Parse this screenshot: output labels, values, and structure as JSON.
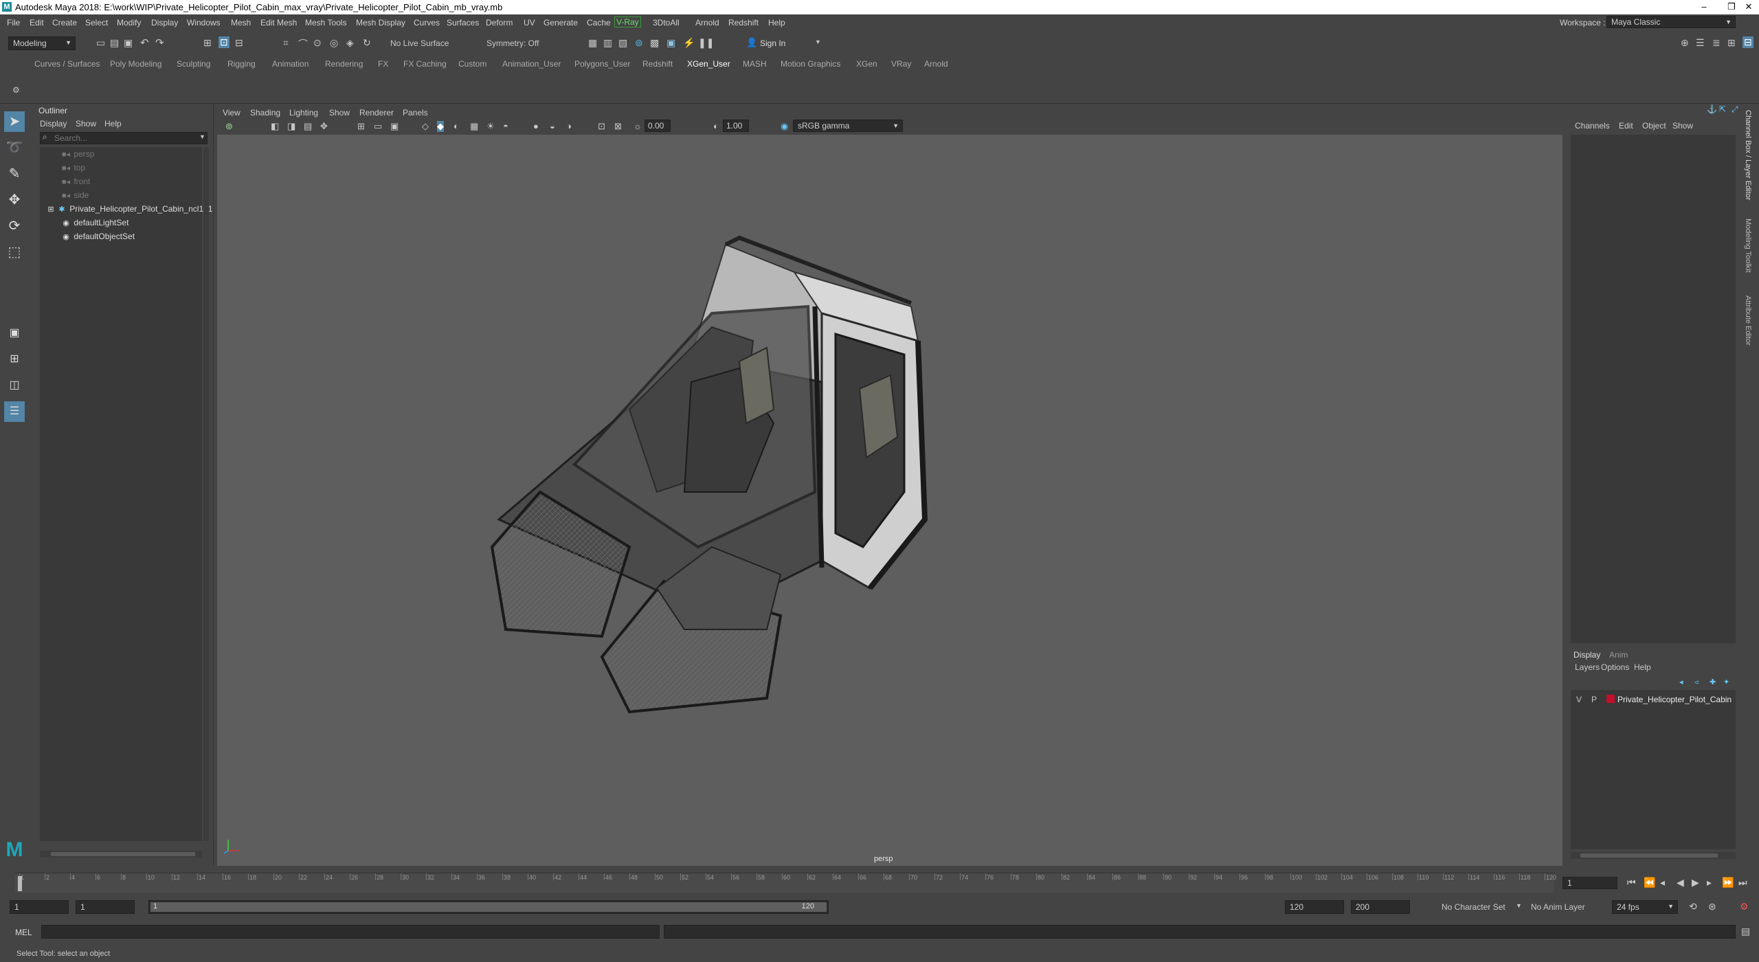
{
  "titlebar": {
    "icon_letter": "M",
    "title": "Autodesk Maya 2018: E:\\work\\WIP\\Private_Helicopter_Pilot_Cabin_max_vray\\Private_Helicopter_Pilot_Cabin_mb_vray.mb",
    "minimize": "–",
    "restore": "❐",
    "close": "✕"
  },
  "menubar": {
    "items": [
      "File",
      "Edit",
      "Create",
      "Select",
      "Modify",
      "Display",
      "Windows",
      "Mesh",
      "Edit Mesh",
      "Mesh Tools",
      "Mesh Display",
      "Curves",
      "Surfaces",
      "Deform",
      "UV",
      "Generate",
      "Cache",
      "V-Ray",
      "3DtoAll",
      "Arnold",
      "Redshift",
      "Help"
    ],
    "workspace_label": "Workspace :",
    "workspace_value": "Maya Classic"
  },
  "statusline": {
    "mode": "Modeling",
    "live_surface": "No Live Surface",
    "symmetry": "Symmetry: Off",
    "sign_in": "Sign In"
  },
  "shelf_tabs": [
    "Curves / Surfaces",
    "Poly Modeling",
    "Sculpting",
    "Rigging",
    "Animation",
    "Rendering",
    "FX",
    "FX Caching",
    "Custom",
    "Animation_User",
    "Polygons_User",
    "Redshift",
    "XGen_User",
    "MASH",
    "Motion Graphics",
    "XGen",
    "VRay",
    "Arnold"
  ],
  "active_shelf_tab": "XGen_User",
  "outliner": {
    "title": "Outliner",
    "menu": [
      "Display",
      "Show",
      "Help"
    ],
    "search_placeholder": "Search...",
    "nodes": [
      {
        "label": "persp",
        "dim": true
      },
      {
        "label": "top",
        "dim": true
      },
      {
        "label": "front",
        "dim": true
      },
      {
        "label": "side",
        "dim": true
      },
      {
        "label": "Private_Helicopter_Pilot_Cabin_ncl1_1",
        "dim": false
      },
      {
        "label": "defaultLightSet",
        "dim": false
      },
      {
        "label": "defaultObjectSet",
        "dim": false
      }
    ]
  },
  "viewport": {
    "menu": [
      "View",
      "Shading",
      "Lighting",
      "Show",
      "Renderer",
      "Panels"
    ],
    "exposure": "0.00",
    "gamma": "1.00",
    "color_space": "sRGB gamma",
    "camera_label": "persp"
  },
  "channel_box": {
    "menu": [
      "Channels",
      "Edit",
      "Object",
      "Show"
    ]
  },
  "layer_editor": {
    "tabs": [
      "Display",
      "Anim"
    ],
    "menu": [
      "Layers",
      "Options",
      "Help"
    ],
    "layer": {
      "v": "V",
      "p": "P",
      "name": "Private_Helicopter_Pilot_Cabin",
      "color": "#c0102a"
    }
  },
  "vertical_tabs": [
    "Channel Box / Layer Editor",
    "Modeling Toolkit",
    "Attribute Editor"
  ],
  "timeline": {
    "ticks": [
      "1",
      "2",
      "4",
      "6",
      "8",
      "10",
      "12",
      "14",
      "16",
      "18",
      "20",
      "22",
      "24",
      "26",
      "28",
      "30",
      "32",
      "34",
      "36",
      "38",
      "40",
      "42",
      "44",
      "46",
      "48",
      "50",
      "52",
      "54",
      "56",
      "58",
      "60",
      "62",
      "64",
      "66",
      "68",
      "70",
      "72",
      "74",
      "76",
      "78",
      "80",
      "82",
      "84",
      "86",
      "88",
      "90",
      "92",
      "94",
      "96",
      "98",
      "100",
      "102",
      "104",
      "106",
      "108",
      "110",
      "112",
      "114",
      "116",
      "118",
      "120"
    ],
    "current_frame": "1"
  },
  "range": {
    "start": "1",
    "inner_start": "1",
    "slider_start": "1",
    "slider_end": "120",
    "end": "120",
    "anim_end": "200",
    "character_set": "No Character Set",
    "anim_layer": "No Anim Layer",
    "fps": "24 fps"
  },
  "cmdline": {
    "label": "MEL"
  },
  "helpline": {
    "text": "Select Tool: select an object"
  }
}
